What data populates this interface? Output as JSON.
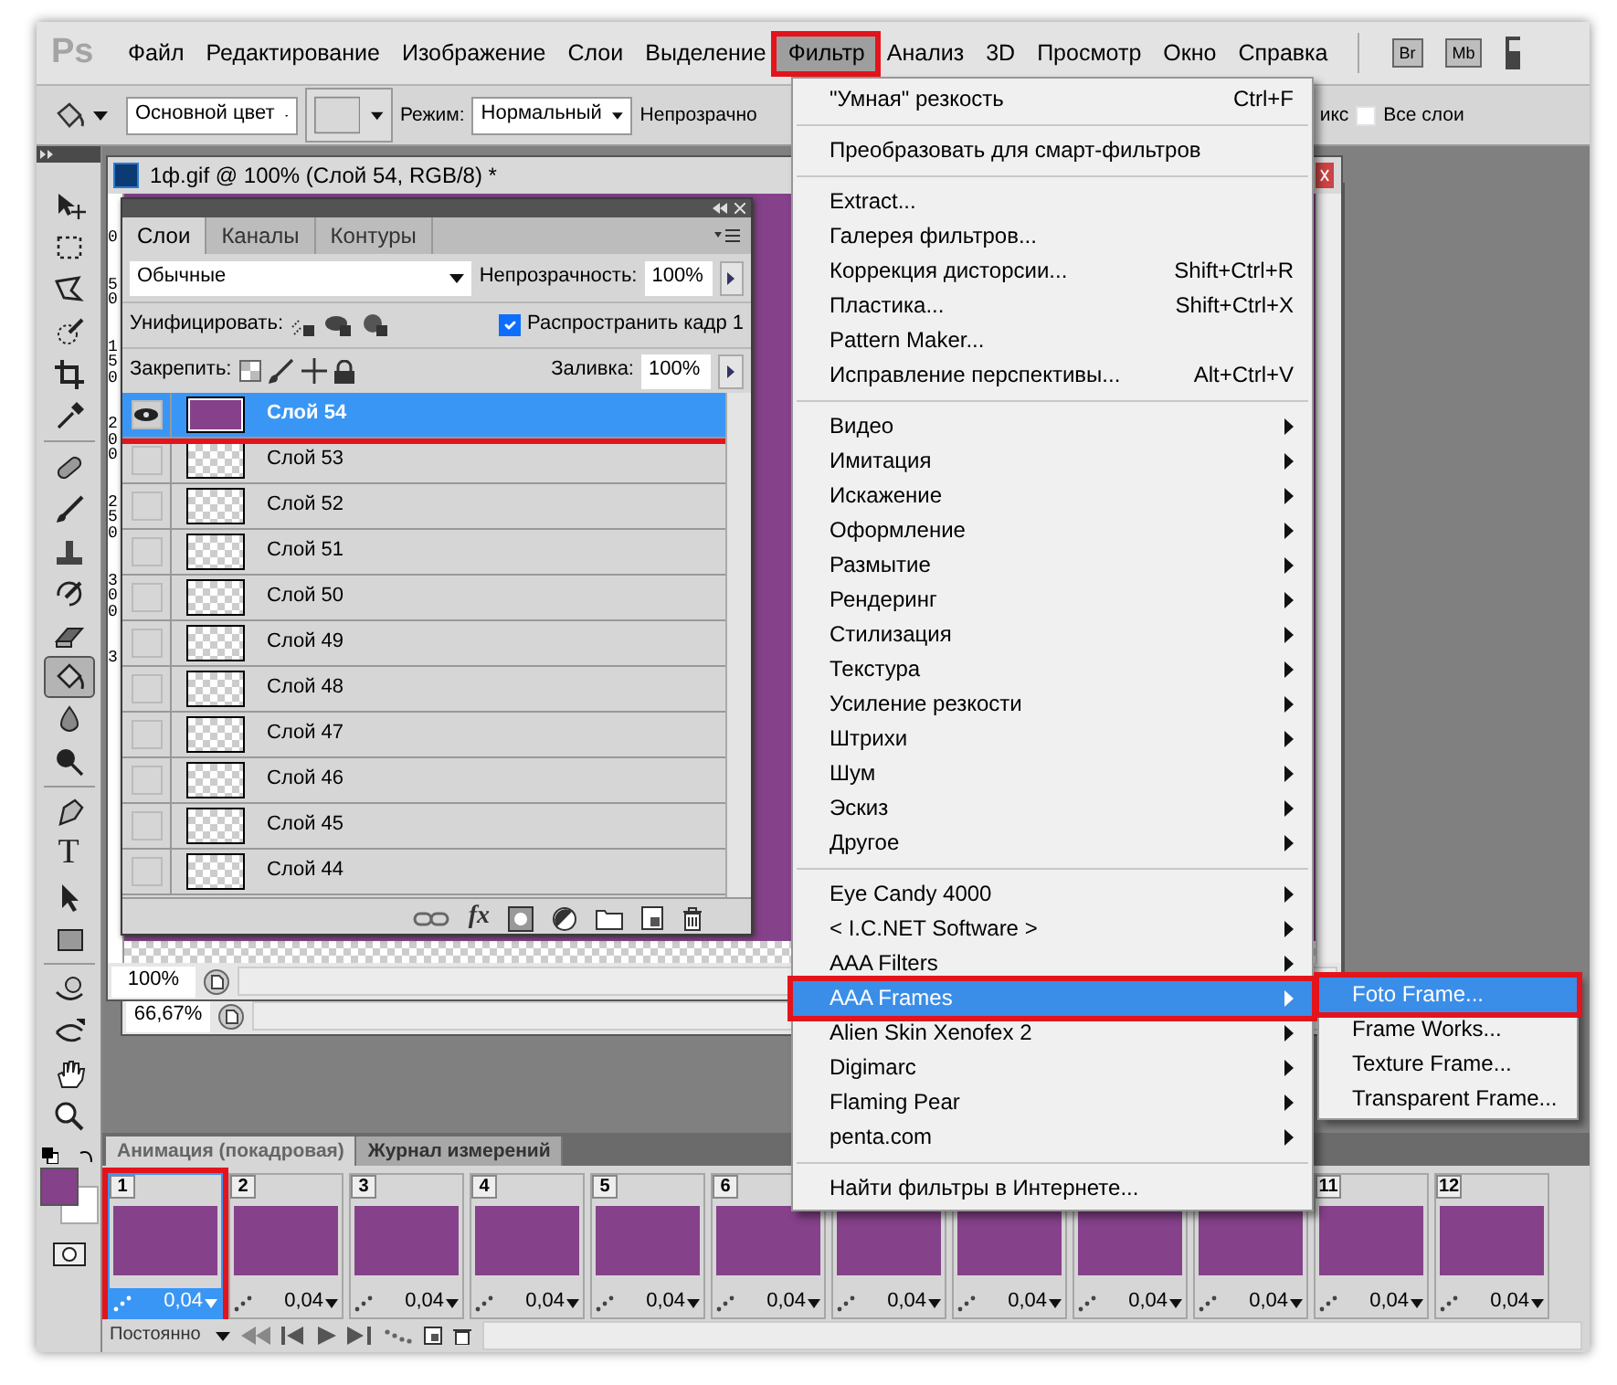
{
  "menu_bar": {
    "logo": "Ps",
    "items": [
      {
        "label": "Файл",
        "selected": false,
        "highlighted": false
      },
      {
        "label": "Редактирование",
        "selected": false,
        "highlighted": false
      },
      {
        "label": "Изображение",
        "selected": false,
        "highlighted": false
      },
      {
        "label": "Слои",
        "selected": false,
        "highlighted": false
      },
      {
        "label": "Выделение",
        "selected": false,
        "highlighted": false
      },
      {
        "label": "Фильтр",
        "selected": true,
        "highlighted": true
      },
      {
        "label": "Анализ",
        "selected": false,
        "highlighted": false
      },
      {
        "label": "3D",
        "selected": false,
        "highlighted": false
      },
      {
        "label": "Просмотр",
        "selected": false,
        "highlighted": false
      },
      {
        "label": "Окно",
        "selected": false,
        "highlighted": false
      },
      {
        "label": "Справка",
        "selected": false,
        "highlighted": false
      }
    ],
    "apps": [
      "Br",
      "Mb"
    ]
  },
  "options_bar": {
    "fill_source": "Основной цвет",
    "mode_label": "Режим:",
    "mode": "Нормальный",
    "opacity_label": "Непрозрачно",
    "contiguous_label": "икс",
    "all_layers": {
      "label": "Все слои",
      "checked": false
    }
  },
  "tools": [
    {
      "kind": "move",
      "selected": false
    },
    {
      "kind": "marquee",
      "selected": false
    },
    {
      "kind": "lasso",
      "selected": false
    },
    {
      "kind": "quick-selection",
      "selected": false
    },
    {
      "kind": "crop",
      "selected": false
    },
    {
      "kind": "eyedropper",
      "selected": false
    },
    {
      "kind": "separator"
    },
    {
      "kind": "bandage",
      "selected": false
    },
    {
      "kind": "brush",
      "selected": false
    },
    {
      "kind": "stamp",
      "selected": false
    },
    {
      "kind": "history-brush",
      "selected": false
    },
    {
      "kind": "eraser",
      "selected": false
    },
    {
      "kind": "bucket",
      "selected": true
    },
    {
      "kind": "drop",
      "selected": false
    },
    {
      "kind": "dodge",
      "selected": false
    },
    {
      "kind": "separator"
    },
    {
      "kind": "pen",
      "selected": false
    },
    {
      "kind": "type",
      "glyph": "T",
      "selected": false
    },
    {
      "kind": "path-selection",
      "selected": false
    },
    {
      "kind": "rectangle",
      "selected": false
    },
    {
      "kind": "separator"
    },
    {
      "kind": "rotate-3d",
      "selected": false
    },
    {
      "kind": "orbit-3d",
      "selected": false
    },
    {
      "kind": "hand",
      "selected": false
    },
    {
      "kind": "zoom",
      "selected": false
    }
  ],
  "documents": [
    {
      "title": "1ф.gif @ 100% (Слой 54, RGB/8) *",
      "zoom": "100%",
      "ruler_labels": [
        "0",
        "50",
        "150",
        "200",
        "250",
        "300",
        "3"
      ]
    },
    {
      "zoom": "66,67%"
    }
  ],
  "layers_panel": {
    "tabs": [
      {
        "label": "Слои",
        "selected": true
      },
      {
        "label": "Каналы",
        "selected": false
      },
      {
        "label": "Контуры",
        "selected": false
      }
    ],
    "blend_mode": "Обычные",
    "opacity_label": "Непрозрачность:",
    "opacity": "100%",
    "unify_label": "Унифицировать:",
    "propagate": {
      "label": "Распространить кадр 1",
      "checked": true
    },
    "lock_label": "Закрепить:",
    "fill_label": "Заливка:",
    "fill": "100%",
    "layers": [
      {
        "name": "Слой 54",
        "visible": true,
        "selected": true,
        "highlighted": true,
        "filled": true
      },
      {
        "name": "Слой 53",
        "visible": false,
        "selected": false,
        "highlighted": false,
        "filled": false
      },
      {
        "name": "Слой 52",
        "visible": false,
        "selected": false,
        "highlighted": false,
        "filled": false
      },
      {
        "name": "Слой 51",
        "visible": false,
        "selected": false,
        "highlighted": false,
        "filled": false
      },
      {
        "name": "Слой 50",
        "visible": false,
        "selected": false,
        "highlighted": false,
        "filled": false
      },
      {
        "name": "Слой 49",
        "visible": false,
        "selected": false,
        "highlighted": false,
        "filled": false
      },
      {
        "name": "Слой 48",
        "visible": false,
        "selected": false,
        "highlighted": false,
        "filled": false
      },
      {
        "name": "Слой 47",
        "visible": false,
        "selected": false,
        "highlighted": false,
        "filled": false
      },
      {
        "name": "Слой 46",
        "visible": false,
        "selected": false,
        "highlighted": false,
        "filled": false
      },
      {
        "name": "Слой 45",
        "visible": false,
        "selected": false,
        "highlighted": false,
        "filled": false
      },
      {
        "name": "Слой 44",
        "visible": false,
        "selected": false,
        "highlighted": false,
        "filled": false
      }
    ],
    "fx_label": "fx"
  },
  "filter_menu": {
    "items": [
      {
        "kind": "item",
        "label": "\"Умная\" резкость",
        "shortcut": "Ctrl+F",
        "submenu": false,
        "selected": false,
        "highlighted": false
      },
      {
        "kind": "separator"
      },
      {
        "kind": "item",
        "label": "Преобразовать для смарт-фильтров",
        "submenu": false,
        "selected": false,
        "highlighted": false
      },
      {
        "kind": "separator"
      },
      {
        "kind": "item",
        "label": "Extract...",
        "submenu": false,
        "selected": false,
        "highlighted": false
      },
      {
        "kind": "item",
        "label": "Галерея фильтров...",
        "submenu": false,
        "selected": false,
        "highlighted": false
      },
      {
        "kind": "item",
        "label": "Коррекция дисторсии...",
        "shortcut": "Shift+Ctrl+R",
        "submenu": false,
        "selected": false,
        "highlighted": false
      },
      {
        "kind": "item",
        "label": "Пластика...",
        "shortcut": "Shift+Ctrl+X",
        "submenu": false,
        "selected": false,
        "highlighted": false
      },
      {
        "kind": "item",
        "label": "Pattern Maker...",
        "submenu": false,
        "selected": false,
        "highlighted": false
      },
      {
        "kind": "item",
        "label": "Исправление перспективы...",
        "shortcut": "Alt+Ctrl+V",
        "submenu": false,
        "selected": false,
        "highlighted": false
      },
      {
        "kind": "separator"
      },
      {
        "kind": "item",
        "label": "Видео",
        "submenu": true,
        "selected": false,
        "highlighted": false
      },
      {
        "kind": "item",
        "label": "Имитация",
        "submenu": true,
        "selected": false,
        "highlighted": false
      },
      {
        "kind": "item",
        "label": "Искажение",
        "submenu": true,
        "selected": false,
        "highlighted": false
      },
      {
        "kind": "item",
        "label": "Оформление",
        "submenu": true,
        "selected": false,
        "highlighted": false
      },
      {
        "kind": "item",
        "label": "Размытие",
        "submenu": true,
        "selected": false,
        "highlighted": false
      },
      {
        "kind": "item",
        "label": "Рендеринг",
        "submenu": true,
        "selected": false,
        "highlighted": false
      },
      {
        "kind": "item",
        "label": "Стилизация",
        "submenu": true,
        "selected": false,
        "highlighted": false
      },
      {
        "kind": "item",
        "label": "Текстура",
        "submenu": true,
        "selected": false,
        "highlighted": false
      },
      {
        "kind": "item",
        "label": "Усиление резкости",
        "submenu": true,
        "selected": false,
        "highlighted": false
      },
      {
        "kind": "item",
        "label": "Штрихи",
        "submenu": true,
        "selected": false,
        "highlighted": false
      },
      {
        "kind": "item",
        "label": "Шум",
        "submenu": true,
        "selected": false,
        "highlighted": false
      },
      {
        "kind": "item",
        "label": "Эскиз",
        "submenu": true,
        "selected": false,
        "highlighted": false
      },
      {
        "kind": "item",
        "label": "Другое",
        "submenu": true,
        "selected": false,
        "highlighted": false
      },
      {
        "kind": "separator"
      },
      {
        "kind": "item",
        "label": "Eye Candy 4000",
        "submenu": true,
        "selected": false,
        "highlighted": false
      },
      {
        "kind": "item",
        "label": "< I.C.NET Software >",
        "submenu": true,
        "selected": false,
        "highlighted": false
      },
      {
        "kind": "item",
        "label": "AAA Filters",
        "submenu": true,
        "selected": false,
        "highlighted": false
      },
      {
        "kind": "item",
        "label": "AAA Frames",
        "submenu": true,
        "selected": true,
        "highlighted": true
      },
      {
        "kind": "item",
        "label": "Alien Skin Xenofex 2",
        "submenu": true,
        "selected": false,
        "highlighted": false
      },
      {
        "kind": "item",
        "label": "Digimarc",
        "submenu": true,
        "selected": false,
        "highlighted": false
      },
      {
        "kind": "item",
        "label": "Flaming Pear",
        "submenu": true,
        "selected": false,
        "highlighted": false
      },
      {
        "kind": "item",
        "label": "penta.com",
        "submenu": true,
        "selected": false,
        "highlighted": false
      },
      {
        "kind": "separator"
      },
      {
        "kind": "item",
        "label": "Найти фильтры в Интернете...",
        "submenu": false,
        "selected": false,
        "highlighted": false
      }
    ]
  },
  "submenu": {
    "items": [
      {
        "label": "Foto Frame...",
        "selected": true,
        "highlighted": true
      },
      {
        "label": "Frame Works...",
        "selected": false,
        "highlighted": false
      },
      {
        "label": "Texture Frame...",
        "selected": false,
        "highlighted": false
      },
      {
        "label": "Transparent Frame...",
        "selected": false,
        "highlighted": false
      }
    ]
  },
  "animation_panel": {
    "tabs": [
      {
        "label": "Анимация (покадровая)",
        "selected": true
      },
      {
        "label": "Журнал измерений",
        "selected": false
      }
    ],
    "frames": [
      {
        "number": "1",
        "delay": "0,04",
        "selected": true,
        "highlighted": true
      },
      {
        "number": "2",
        "delay": "0,04",
        "selected": false,
        "highlighted": false
      },
      {
        "number": "3",
        "delay": "0,04",
        "selected": false,
        "highlighted": false
      },
      {
        "number": "4",
        "delay": "0,04",
        "selected": false,
        "highlighted": false
      },
      {
        "number": "5",
        "delay": "0,04",
        "selected": false,
        "highlighted": false
      },
      {
        "number": "6",
        "delay": "0,04",
        "selected": false,
        "highlighted": false
      },
      {
        "delay": "0,04",
        "selected": false,
        "highlighted": false
      },
      {
        "delay": "0,04",
        "selected": false,
        "highlighted": false
      },
      {
        "delay": "0,04",
        "selected": false,
        "highlighted": false
      },
      {
        "delay": "0,04",
        "selected": false,
        "highlighted": false
      },
      {
        "number": "11",
        "delay": "0,04",
        "selected": false,
        "highlighted": false
      },
      {
        "number": "12",
        "delay": "0,04",
        "selected": false,
        "highlighted": false
      }
    ],
    "loop": "Постоянно"
  }
}
